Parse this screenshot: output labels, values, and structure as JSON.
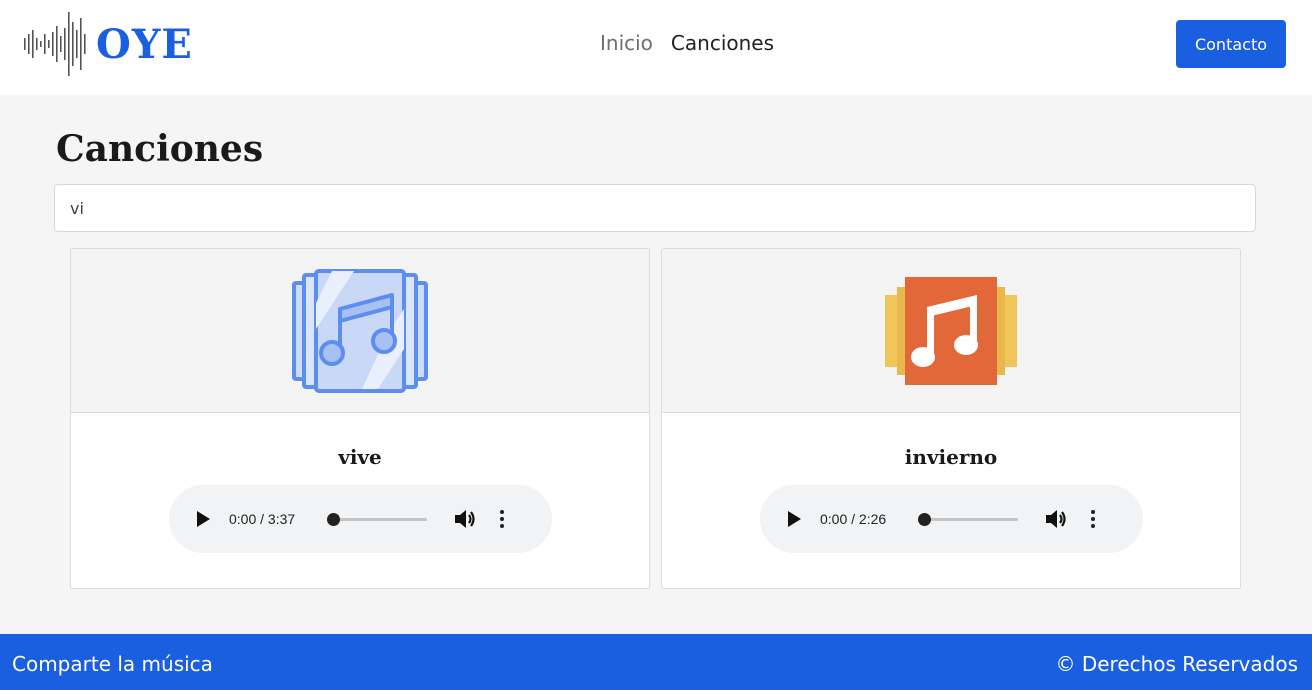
{
  "brand": {
    "name": "OYE",
    "color": "#1a5fe0"
  },
  "nav": {
    "links": [
      {
        "label": "Inicio",
        "active": false
      },
      {
        "label": "Canciones",
        "active": true
      }
    ],
    "contact_label": "Contacto"
  },
  "page": {
    "title": "Canciones",
    "search_value": "vi"
  },
  "songs": [
    {
      "title": "vive",
      "cover_icon": "music-album-blue-icon",
      "time": "0:00 / 3:37",
      "progress": 0
    },
    {
      "title": "invierno",
      "cover_icon": "music-album-orange-icon",
      "time": "0:00 / 2:26",
      "progress": 0
    }
  ],
  "player_icons": [
    "play-icon",
    "volume-icon",
    "more-options-icon"
  ],
  "footer": {
    "left": "Comparte la música",
    "right": "© Derechos Reservados"
  },
  "colors": {
    "accent": "#1a5fe0",
    "cover_blue": "#5b8ef0",
    "cover_orange": "#e2683a",
    "cover_yellow": "#f0c65a"
  }
}
